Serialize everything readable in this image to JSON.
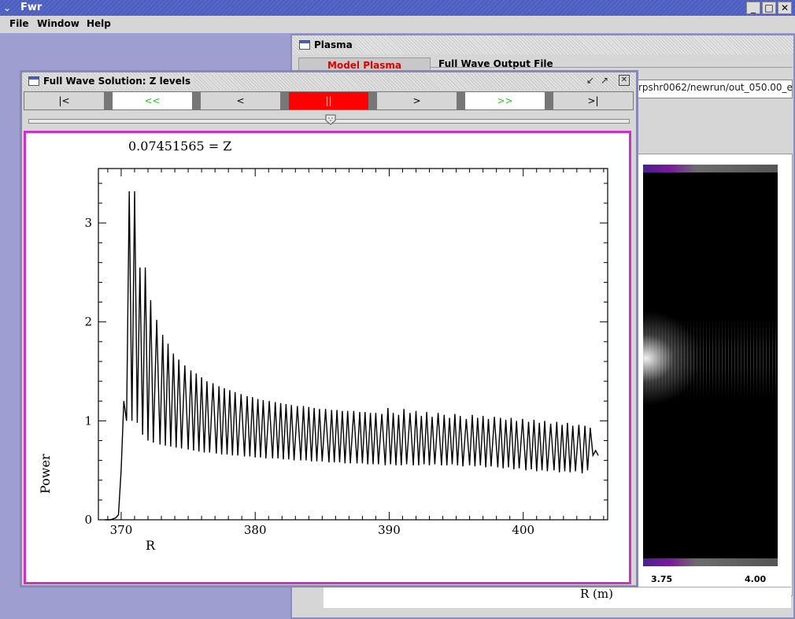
{
  "app": {
    "title": "Fwr",
    "menu": [
      "File",
      "Window",
      "Help"
    ]
  },
  "plasma_window": {
    "title": "Plasma",
    "tabs": [
      {
        "label": "Model Plasma",
        "active": true,
        "color": "#e00000"
      },
      {
        "label": "Full Wave Output File",
        "active": false
      }
    ],
    "output_path": "rpshr0062/newrun/out_050.00_e",
    "x_ticks": [
      "3.75",
      "4.00"
    ],
    "x_label": "R (m)"
  },
  "fullwave_window": {
    "title": "Full Wave Solution:  Z levels",
    "nav_buttons": [
      {
        "label": "|<",
        "style": "normal"
      },
      {
        "label": "<<",
        "style": "white"
      },
      {
        "label": "<",
        "style": "normal"
      },
      {
        "label": "||",
        "style": "red"
      },
      {
        "label": ">",
        "style": "normal"
      },
      {
        "label": ">>",
        "style": "white"
      },
      {
        "label": ">|",
        "style": "normal"
      }
    ],
    "slider_position": 0.5,
    "plot_frame_color": "#d030c8"
  },
  "chart_data": {
    "type": "line",
    "title": "0.07451565  = Z",
    "xlabel": "R",
    "ylabel": "Power",
    "xlim": [
      368.3,
      406.3
    ],
    "ylim": [
      0,
      3.55
    ],
    "x_ticks": [
      370,
      380,
      390,
      400
    ],
    "y_ticks": [
      0,
      1,
      2,
      3
    ],
    "series": [
      {
        "color": "#000000",
        "x": [
          368.8,
          369.6,
          370.0,
          370.4,
          370.8,
          371.2,
          371.6,
          372.0,
          372.4,
          372.9,
          373.3,
          373.7,
          374.1,
          374.5,
          375.0,
          375.4,
          375.8,
          376.2,
          376.6,
          377.1,
          377.5,
          377.9,
          378.3,
          378.7,
          379.2,
          379.6,
          380.0,
          380.4,
          380.8,
          381.3,
          381.7,
          382.1,
          382.5,
          382.9,
          383.4,
          383.8,
          384.2,
          384.6,
          385.0,
          385.5,
          385.9,
          386.3,
          386.7,
          387.1,
          387.6,
          388.0,
          388.4,
          388.8,
          389.2,
          389.7,
          390.1,
          390.5,
          390.9,
          391.3,
          391.8,
          392.2,
          392.6,
          393.0,
          393.4,
          393.9,
          394.3,
          394.7,
          395.1,
          395.5,
          396.0,
          396.4,
          396.8,
          397.2,
          397.6,
          398.1,
          398.5,
          398.9,
          399.3,
          399.7,
          400.2,
          400.6,
          401.0,
          401.4,
          401.8,
          402.3,
          402.7,
          403.1,
          403.5,
          403.9,
          404.4,
          404.8,
          405.2
        ],
        "peaks": [
          0.0,
          0.05,
          1.2,
          3.32,
          3.32,
          2.55,
          2.55,
          2.22,
          2.02,
          1.87,
          1.78,
          1.68,
          1.62,
          1.56,
          1.51,
          1.48,
          1.44,
          1.4,
          1.38,
          1.35,
          1.33,
          1.31,
          1.29,
          1.27,
          1.25,
          1.24,
          1.22,
          1.21,
          1.2,
          1.19,
          1.18,
          1.17,
          1.16,
          1.15,
          1.15,
          1.14,
          1.13,
          1.12,
          1.12,
          1.11,
          1.11,
          1.1,
          1.1,
          1.1,
          1.09,
          1.09,
          1.08,
          1.08,
          1.07,
          1.13,
          1.08,
          1.06,
          1.12,
          1.08,
          1.1,
          1.05,
          1.09,
          1.04,
          1.08,
          1.06,
          1.03,
          1.07,
          1.05,
          1.02,
          1.06,
          1.03,
          1.05,
          1.02,
          1.04,
          1.03,
          1.01,
          1.03,
          1.0,
          1.02,
          0.99,
          1.01,
          0.98,
          1.0,
          0.97,
          0.99,
          0.96,
          0.98,
          0.95,
          0.96,
          0.95,
          0.93,
          0.7
        ],
        "troughs": [
          0.0,
          0.02,
          0.5,
          1.0,
          1.0,
          0.98,
          0.86,
          0.8,
          0.78,
          0.76,
          0.75,
          0.74,
          0.73,
          0.72,
          0.71,
          0.7,
          0.69,
          0.68,
          0.68,
          0.67,
          0.66,
          0.66,
          0.65,
          0.65,
          0.64,
          0.64,
          0.63,
          0.63,
          0.62,
          0.62,
          0.62,
          0.61,
          0.61,
          0.6,
          0.6,
          0.6,
          0.59,
          0.59,
          0.59,
          0.58,
          0.58,
          0.58,
          0.57,
          0.57,
          0.57,
          0.57,
          0.56,
          0.56,
          0.56,
          0.55,
          0.56,
          0.55,
          0.55,
          0.56,
          0.55,
          0.55,
          0.56,
          0.55,
          0.56,
          0.55,
          0.55,
          0.56,
          0.55,
          0.54,
          0.55,
          0.54,
          0.55,
          0.53,
          0.54,
          0.53,
          0.52,
          0.53,
          0.51,
          0.52,
          0.5,
          0.51,
          0.49,
          0.5,
          0.49,
          0.5,
          0.48,
          0.49,
          0.48,
          0.49,
          0.47,
          0.5,
          0.65
        ]
      }
    ]
  }
}
